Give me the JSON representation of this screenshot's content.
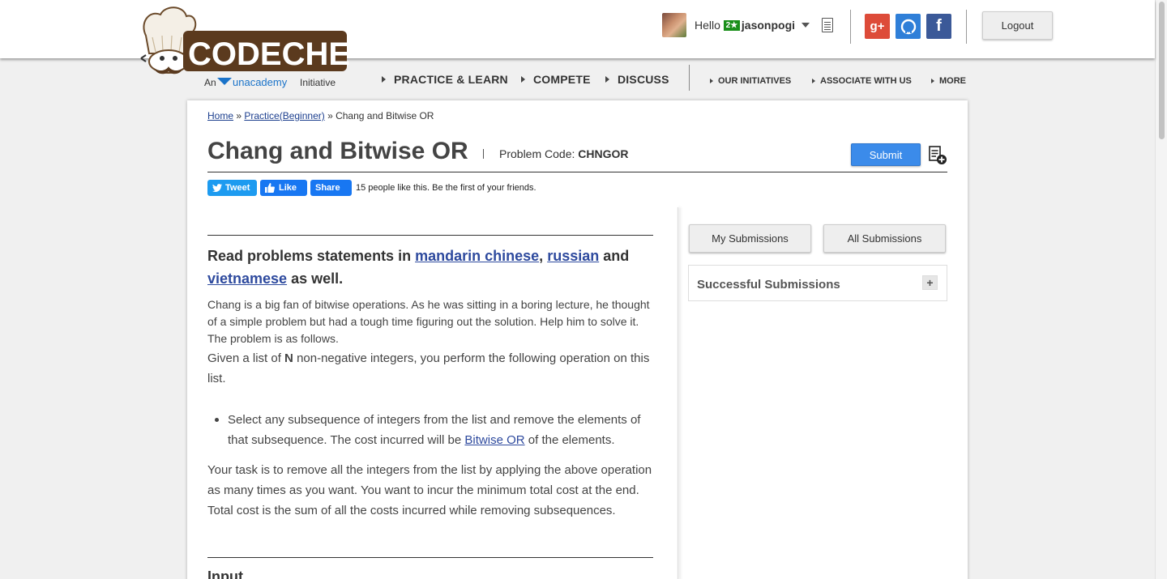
{
  "header": {
    "logo_text": "CODECHEF",
    "logo_tagline_prefix": "An",
    "logo_tagline_brand": "unacademy",
    "logo_tagline_suffix": "Initiative",
    "greeting": "Hello",
    "star_badge": "2★",
    "username": "jasonpogi",
    "logout_label": "Logout",
    "social": {
      "gplus": "g+",
      "fb": "f"
    }
  },
  "nav": {
    "primary": [
      "PRACTICE & LEARN",
      "COMPETE",
      "DISCUSS"
    ],
    "secondary": [
      "OUR INITIATIVES",
      "ASSOCIATE WITH US",
      "MORE"
    ]
  },
  "breadcrumb": {
    "home": "Home",
    "sep1": " » ",
    "practice": "Practice(Beginner)",
    "sep2": " » ",
    "current": "Chang and Bitwise OR"
  },
  "problem": {
    "title": "Chang and Bitwise OR",
    "code_label": "Problem Code:",
    "code": "CHNGOR",
    "submit_label": "Submit",
    "lang_prefix": "Read problems statements in",
    "lang1": "mandarin chinese",
    "lang_comma": ",",
    "lang2": "russian",
    "lang_and": "and",
    "lang3": "vietnamese",
    "lang_suffix": "as well.",
    "intro": "Chang is a big fan of bitwise operations. As he was sitting in a boring lecture, he thought of a simple problem but had a tough time figuring out the solution. Help him to solve it. The problem is as follows.",
    "given_prefix": "Given a list of",
    "given_n": "N",
    "given_suffix": "non-negative integers, you perform the following operation on this list.",
    "bullet_prefix": "Select any subsequence of integers from the list and remove the elements of that subsequence. The cost incurred will be",
    "bullet_link": "Bitwise OR",
    "bullet_suffix": "of the elements.",
    "task": "Your task is to remove all the integers from the list by applying the above operation as many times as you want. You want to incur the minimum total cost at the end. Total cost is the sum of all the costs incurred while removing subsequences.",
    "input_heading": "Input"
  },
  "share": {
    "tweet": "Tweet",
    "like": "Like",
    "share": "Share",
    "like_text": "15 people like this. Be the first of your friends."
  },
  "sidebar": {
    "my_submissions": "My Submissions",
    "all_submissions": "All Submissions",
    "successful_submissions": "Successful Submissions",
    "expand": "+"
  }
}
